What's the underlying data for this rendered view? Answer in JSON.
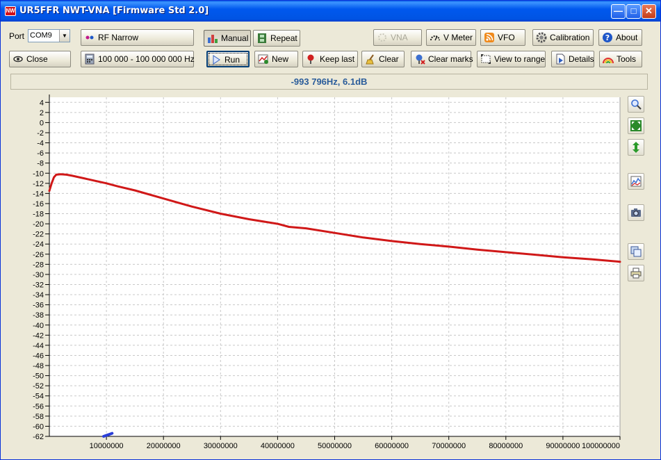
{
  "window": {
    "title": "UR5FFR NWT-VNA [Firmware Std 2.0]",
    "icon_text": "NW"
  },
  "toolbar": {
    "port_label": "Port",
    "port_value": "COM9",
    "rf_mode": "RF Narrow",
    "manual": "Manual",
    "repeat": "Repeat",
    "vna": "VNA",
    "vmeter": "V Meter",
    "vfo": "VFO",
    "calibration": "Calibration",
    "about": "About",
    "close": "Close",
    "range": "100 000 - 100 000 000 Hz",
    "run": "Run",
    "new": "New",
    "keep_last": "Keep last",
    "clear": "Clear",
    "clear_marks": "Clear marks",
    "view_to_range": "View to range",
    "details": "Details",
    "tools": "Tools"
  },
  "status": {
    "readout": "-993 796Hz, 6.1dB"
  },
  "side_tools": [
    "zoom-icon",
    "fit-icon",
    "vertical-scale-icon",
    "chart-icon",
    "camera-icon",
    "copy-icon",
    "print-icon"
  ],
  "colors": {
    "trace": "#d01818",
    "marker": "#2b3fd8",
    "readout": "#2a5c9a"
  },
  "chart_data": {
    "type": "line",
    "x_ticks": [
      "10000000",
      "20000000",
      "30000000",
      "40000000",
      "50000000",
      "60000000",
      "70000000",
      "80000000",
      "90000000",
      "100000000"
    ],
    "y_ticks": [
      "4",
      "2",
      "0",
      "-2",
      "-4",
      "-6",
      "-8",
      "-10",
      "-12",
      "-14",
      "-16",
      "-18",
      "-20",
      "-22",
      "-24",
      "-26",
      "-28",
      "-30",
      "-32",
      "-34",
      "-36",
      "-38",
      "-40",
      "-42",
      "-44",
      "-46",
      "-48",
      "-50",
      "-52",
      "-54",
      "-56",
      "-58",
      "-60",
      "-62"
    ],
    "xlim": [
      0,
      100000000
    ],
    "ylim": [
      -62,
      5
    ],
    "grid": true,
    "series": [
      {
        "color": "#d01818",
        "x": [
          0,
          400000,
          800000,
          1200000,
          2000000,
          3000000,
          4000000,
          6000000,
          8000000,
          10000000,
          12000000,
          15000000,
          20000000,
          25000000,
          30000000,
          35000000,
          40000000,
          42000000,
          45000000,
          50000000,
          55000000,
          60000000,
          65000000,
          70000000,
          75000000,
          80000000,
          85000000,
          90000000,
          95000000,
          100000000
        ],
        "y": [
          -13.5,
          -12.0,
          -10.8,
          -10.3,
          -10.2,
          -10.3,
          -10.5,
          -11.0,
          -11.5,
          -12.0,
          -12.6,
          -13.4,
          -15.0,
          -16.6,
          -18.0,
          -19.1,
          -20.0,
          -20.6,
          -20.9,
          -21.8,
          -22.7,
          -23.4,
          -24.0,
          -24.5,
          -25.1,
          -25.6,
          -26.1,
          -26.6,
          -27.0,
          -27.5
        ]
      },
      {
        "color": "#2b3fd8",
        "x": [
          9500000,
          10000000,
          10500000,
          11000000
        ],
        "y": [
          -62,
          -61.8,
          -61.6,
          -61.4
        ]
      }
    ]
  }
}
